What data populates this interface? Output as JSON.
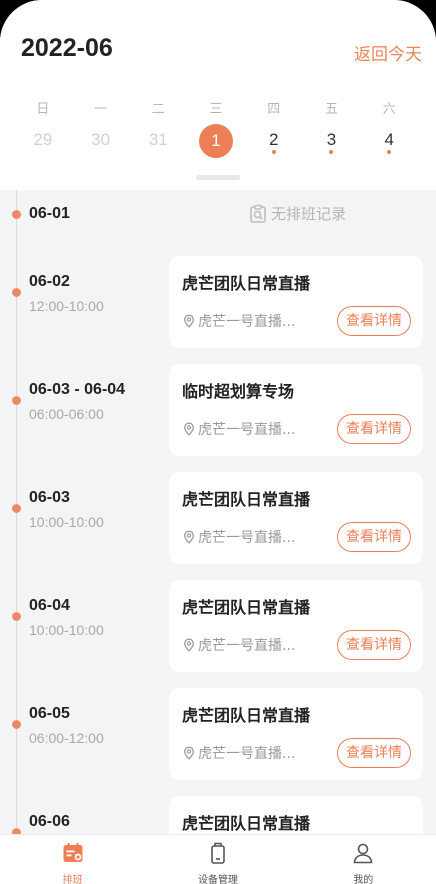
{
  "header": {
    "month": "2022-06",
    "today_label": "返回今天"
  },
  "calendar": {
    "weekdays": [
      "日",
      "一",
      "二",
      "三",
      "四",
      "五",
      "六"
    ],
    "dates": [
      {
        "num": "29",
        "state": "past",
        "dot": false
      },
      {
        "num": "30",
        "state": "past",
        "dot": false
      },
      {
        "num": "31",
        "state": "past",
        "dot": false
      },
      {
        "num": "1",
        "state": "selected",
        "dot": false
      },
      {
        "num": "2",
        "state": "normal",
        "dot": true
      },
      {
        "num": "3",
        "state": "normal",
        "dot": true
      },
      {
        "num": "4",
        "state": "normal",
        "dot": true
      }
    ]
  },
  "schedule": {
    "empty": {
      "date": "06-01",
      "text": "无排班记录"
    },
    "items": [
      {
        "date": "06-02",
        "time": "12:00-10:00",
        "title": "虎芒团队日常直播",
        "location": "虎芒一号直播...",
        "button": "查看详情"
      },
      {
        "date": "06-03 - 06-04",
        "time": "06:00-06:00",
        "title": "临时超划算专场",
        "location": "虎芒一号直播...",
        "button": "查看详情"
      },
      {
        "date": "06-03",
        "time": "10:00-10:00",
        "title": "虎芒团队日常直播",
        "location": "虎芒一号直播...",
        "button": "查看详情"
      },
      {
        "date": "06-04",
        "time": "10:00-10:00",
        "title": "虎芒团队日常直播",
        "location": "虎芒一号直播...",
        "button": "查看详情"
      },
      {
        "date": "06-05",
        "time": "06:00-12:00",
        "title": "虎芒团队日常直播",
        "location": "虎芒一号直播...",
        "button": "查看详情"
      },
      {
        "date": "06-06",
        "time": "",
        "title": "虎芒团队日常直播",
        "location": "",
        "button": ""
      }
    ]
  },
  "tabbar": {
    "tabs": [
      {
        "label": "排班",
        "icon": "calendar-icon",
        "active": true
      },
      {
        "label": "设备管理",
        "icon": "device-icon",
        "active": false
      },
      {
        "label": "我的",
        "icon": "user-icon",
        "active": false
      }
    ]
  },
  "colors": {
    "accent": "#ec7f56",
    "background": "#f3f4f6"
  }
}
